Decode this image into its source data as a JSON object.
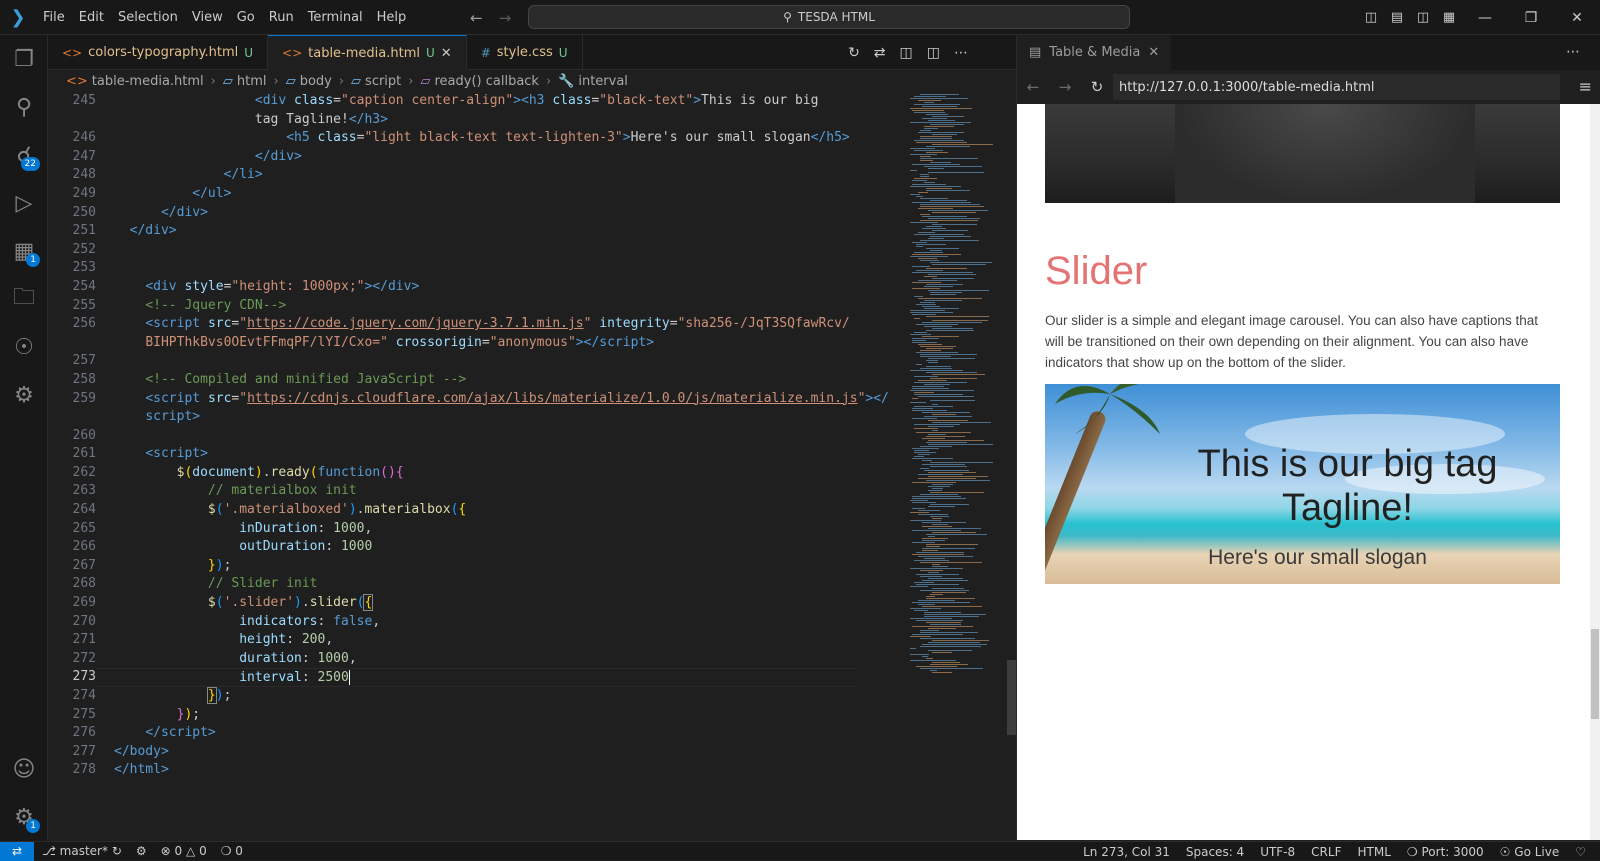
{
  "titlebar": {
    "menu": [
      "File",
      "Edit",
      "Selection",
      "View",
      "Go",
      "Run",
      "Terminal",
      "Help"
    ],
    "search": "TESDA HTML"
  },
  "activity_badges": {
    "source_control": "22",
    "extensions": "1",
    "settings": "1"
  },
  "tabs": [
    {
      "label": "colors-typography.html",
      "status": "U"
    },
    {
      "label": "table-media.html",
      "status": "U"
    },
    {
      "label": "style.css",
      "status": "U"
    }
  ],
  "breadcrumb": [
    "table-media.html",
    "html",
    "body",
    "script",
    "ready() callback",
    "interval"
  ],
  "editor": {
    "line_numbers": [
      "245",
      "",
      "246",
      "247",
      "248",
      "249",
      "250",
      "251",
      "252",
      "253",
      "254",
      "255",
      "256",
      "",
      "257",
      "258",
      "259",
      "",
      "260",
      "261",
      "262",
      "263",
      "264",
      "265",
      "266",
      "267",
      "268",
      "269",
      "270",
      "271",
      "272",
      "273",
      "274",
      "275",
      "276",
      "277",
      "278"
    ]
  },
  "preview": {
    "tab_label": "Table & Media",
    "url": "http://127.0.0.1:3000/table-media.html",
    "heading": "Slider",
    "paragraph": "Our slider is a simple and elegant image carousel. You can also have captions that will be transitioned on their own depending on their alignment. You can also have indicators that show up on the bottom of the slider.",
    "caption_title": "This is our big tag Tagline!",
    "caption_slogan": "Here's our small slogan"
  },
  "statusbar": {
    "branch": "master*",
    "problems": "0",
    "warnings": "0",
    "ports": "0",
    "cursor": "Ln 273, Col 31",
    "spaces": "Spaces: 4",
    "encoding": "UTF-8",
    "eol": "CRLF",
    "language": "HTML",
    "port": "Port: 3000",
    "golive": "Go Live"
  },
  "colors": {
    "accent": "#0078d4",
    "heading": "#e57373",
    "editor_bg": "#1f1f1f"
  }
}
